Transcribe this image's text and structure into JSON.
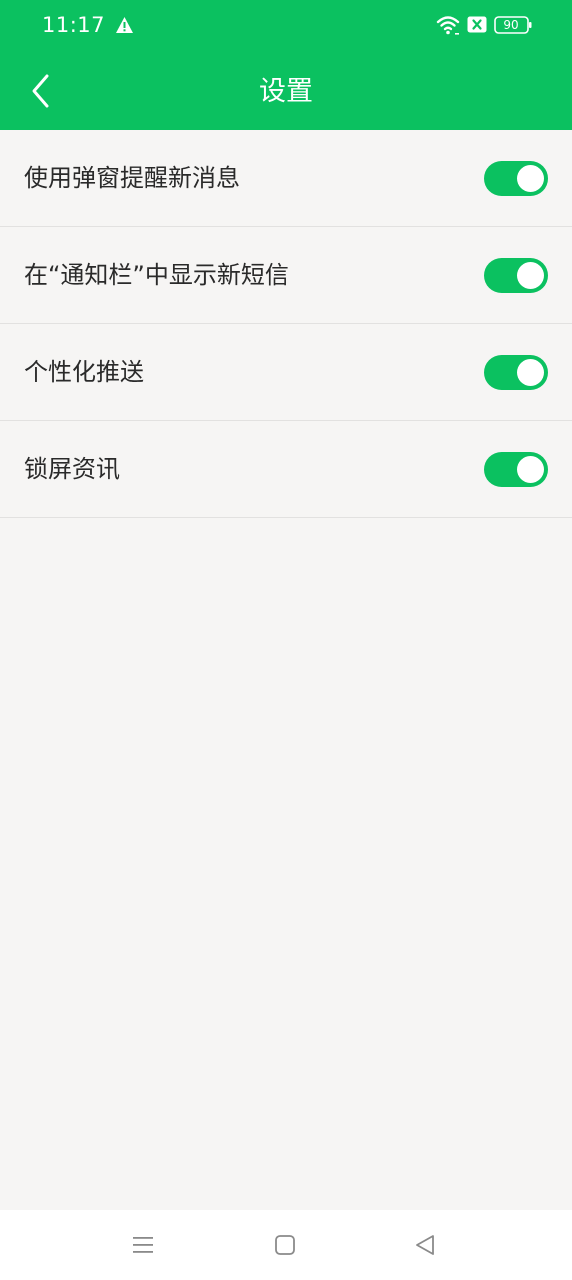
{
  "status_bar": {
    "time": "11:17",
    "battery": "90",
    "icons": [
      "alert-icon",
      "wifi-icon",
      "sim-icon",
      "battery-icon"
    ]
  },
  "header": {
    "title": "设置",
    "back_icon": "chevron-left-icon",
    "background_color": "#0bc160"
  },
  "settings": [
    {
      "label": "使用弹窗提醒新消息",
      "enabled": true
    },
    {
      "label": "在“通知栏”中显示新短信",
      "enabled": true
    },
    {
      "label": "个性化推送",
      "enabled": true
    },
    {
      "label": "锁屏资讯",
      "enabled": true
    }
  ],
  "nav_bar": {
    "icons": [
      "menu-icon",
      "home-icon",
      "back-triangle-icon"
    ]
  },
  "colors": {
    "accent": "#0bc160",
    "background": "#f6f5f4",
    "divider": "#e2e1e0"
  }
}
